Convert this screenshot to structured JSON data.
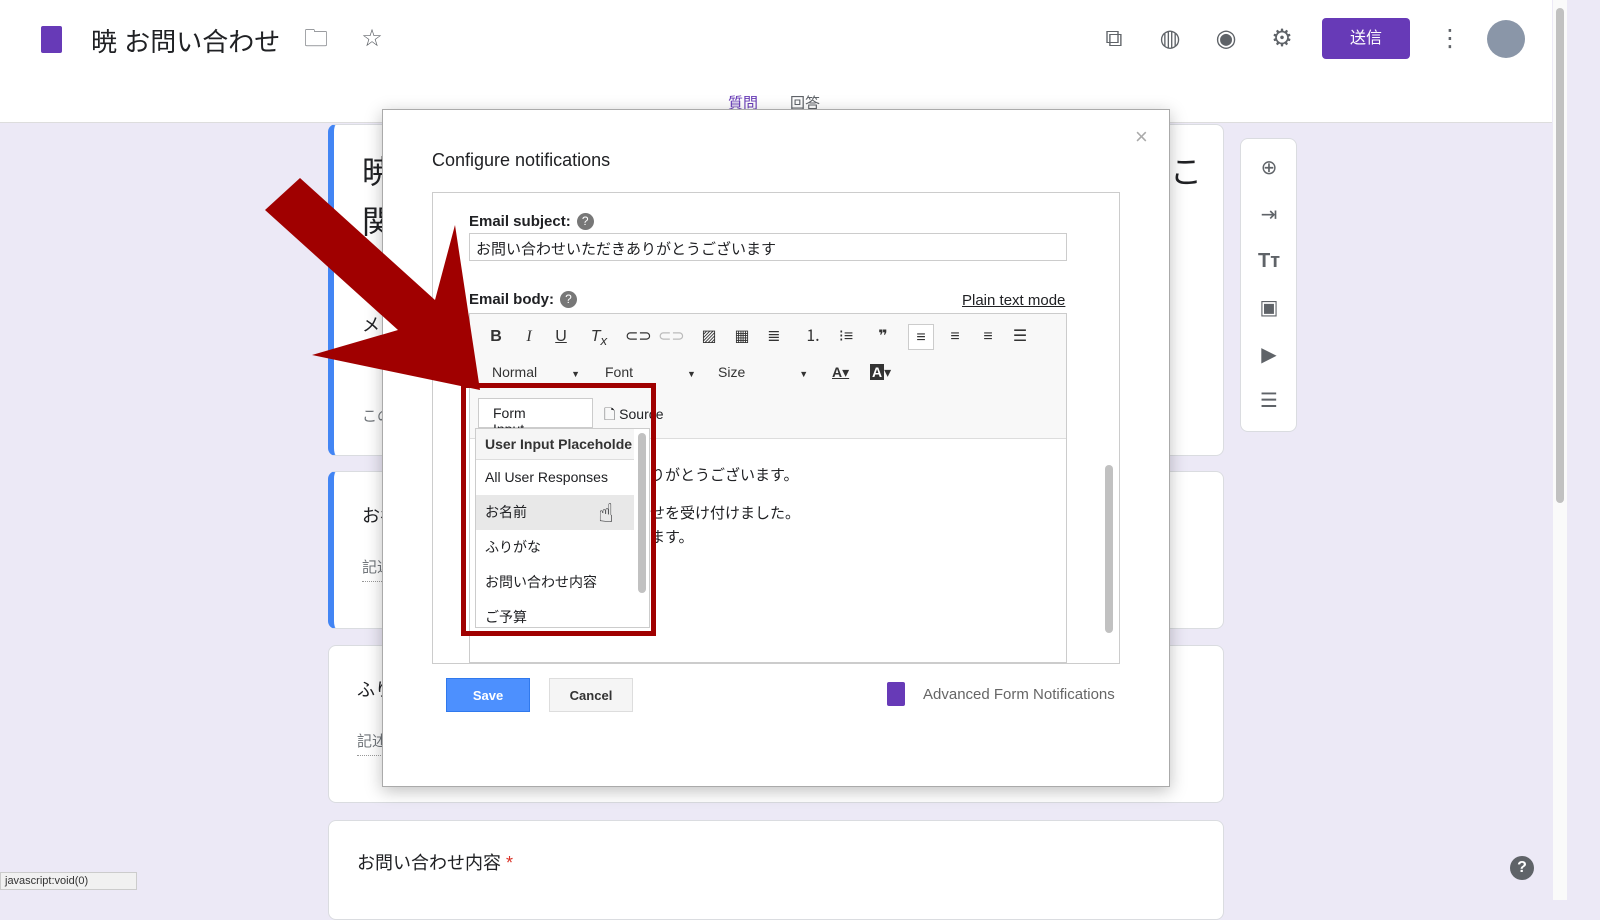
{
  "header": {
    "title": "暁 お問い合わせ",
    "send": "送信",
    "tabs": [
      "質問",
      "回答"
    ]
  },
  "colors": {
    "accent": "#673ab7",
    "highlight": "#a00000",
    "save": "#4d90fe"
  },
  "form": {
    "title_partial": [
      "暁",
      "関"
    ],
    "title_right": "こ",
    "email_partial": "メ",
    "desc_partial": "この",
    "q1": "お名",
    "q1_sub": "記述",
    "q2": "ふり",
    "q2_sub": "記述",
    "q3": "お問い合わせ内容",
    "required": "*"
  },
  "dialog": {
    "title": "Configure notifications",
    "close": "×",
    "subject_label": "Email subject:",
    "subject_value": "お問い合わせいただきありがとうございます",
    "body_label": "Email body:",
    "plain_text": "Plain text mode",
    "help": "?",
    "toolbar": {
      "style": "Normal",
      "font": "Font",
      "size": "Size",
      "form_input": "Form Input",
      "source": "Source"
    },
    "body_lines": [
      "りがとうございます。",
      "せを受け付けました。",
      "ます。"
    ],
    "menu": [
      "User Input Placeholde",
      "All User Responses",
      "お名前",
      "ふりがな",
      "お問い合わせ内容",
      "ご予算"
    ],
    "save": "Save",
    "cancel": "Cancel",
    "addon": "Advanced Form Notifications"
  },
  "status_bar": "javascript:void(0)"
}
